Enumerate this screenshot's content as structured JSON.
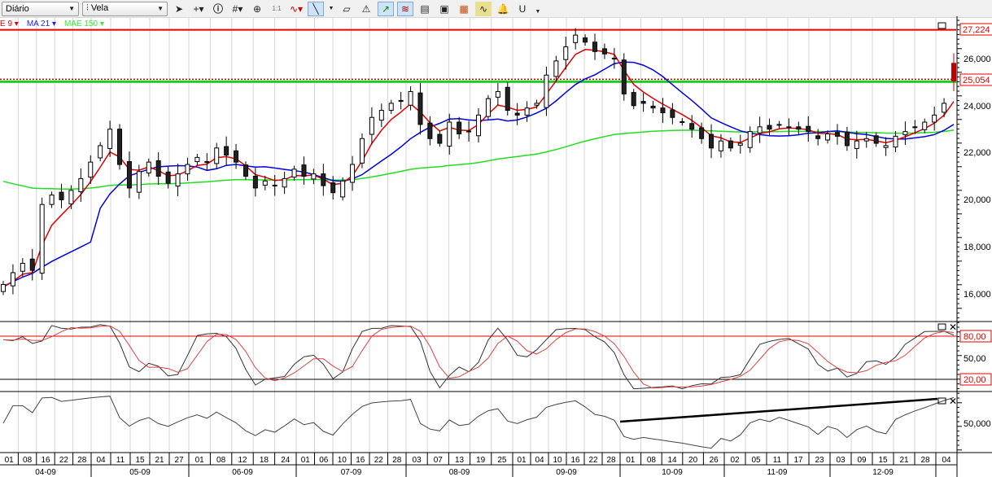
{
  "toolbar": {
    "period": "Diário",
    "chart_type": "Vela",
    "zoom_label": "1:1",
    "icons": [
      "cursor-icon",
      "crosshair-icon",
      "info-icon",
      "grid-icon",
      "zoom-icon",
      "one-to-one-icon",
      "indicator-icon",
      "trendline-icon",
      "eraser-icon",
      "alert-draw-icon",
      "line-tool-icon",
      "multi-line-icon",
      "template-icon",
      "copy-chart-icon",
      "save-chart-icon",
      "study-icon",
      "bell-icon",
      "magnet-icon",
      "more-icon"
    ]
  },
  "legend": {
    "ema": "E 9 ▾",
    "ma": "MA 21 ▾",
    "mae": "MAE 150 ▾"
  },
  "colors": {
    "ema": "#e00000",
    "ma": "#0000e0",
    "mae": "#22dd22",
    "resistance": "#e00000",
    "support": "#22cc22"
  },
  "price_axis": {
    "labels": [
      "26,000",
      "24,000",
      "22,000",
      "20,000",
      "18,000",
      "16,000"
    ],
    "resistance_label": "27,224",
    "support_label": "25,054",
    "last_label": "25,054"
  },
  "stoch_axis": {
    "upper": "80,00",
    "mid": "50,00",
    "lower": "20,00"
  },
  "rsi_axis": {
    "mid": "50,000"
  },
  "chart_data": {
    "type": "candlestick",
    "resistance": 27.224,
    "support": 25.054,
    "mae150_seed": 20.9,
    "closes": [
      16.4,
      16.9,
      17.3,
      17.0,
      19.8,
      20.2,
      20.0,
      20.4,
      20.9,
      21.6,
      22.3,
      23.0,
      21.5,
      20.5,
      21.2,
      21.6,
      21.0,
      20.7,
      21.1,
      21.5,
      21.8,
      21.6,
      22.2,
      21.9,
      21.6,
      21.0,
      20.5,
      20.8,
      20.6,
      20.9,
      21.3,
      21.0,
      21.1,
      20.6,
      20.3,
      20.8,
      21.5,
      22.6,
      23.5,
      23.8,
      24.1,
      24.2,
      24.6,
      23.2,
      22.6,
      22.4,
      23.3,
      22.8,
      22.9,
      23.6,
      24.3,
      24.6,
      23.8,
      23.6,
      23.9,
      24.1,
      25.3,
      25.9,
      26.5,
      27.0,
      26.7,
      26.3,
      26.2,
      26.0,
      24.5,
      24.0,
      24.1,
      23.9,
      23.7,
      23.5,
      23.3,
      23.0,
      22.6,
      22.2,
      22.5,
      22.2,
      22.4,
      22.9,
      23.1,
      23.0,
      23.2,
      23.1,
      23.0,
      22.9,
      22.6,
      22.8,
      22.7,
      22.3,
      22.5,
      22.6,
      22.4,
      22.3,
      22.7,
      22.9,
      23.1,
      23.3,
      23.6,
      24.1,
      25.05
    ],
    "last_open": 25.8,
    "last_high": 25.9
  },
  "x_axis": {
    "months": [
      {
        "label": "04-09",
        "days": [
          "01",
          "08",
          "16",
          "22",
          "28"
        ]
      },
      {
        "label": "05-09",
        "days": [
          "04",
          "11",
          "15",
          "21",
          "27"
        ]
      },
      {
        "label": "06-09",
        "days": [
          "01",
          "08",
          "12",
          "18",
          "24"
        ]
      },
      {
        "label": "07-09",
        "days": [
          "01",
          "06",
          "10",
          "16",
          "22",
          "28"
        ]
      },
      {
        "label": "08-09",
        "days": [
          "03",
          "07",
          "13",
          "19",
          "25"
        ]
      },
      {
        "label": "09-09",
        "days": [
          "01",
          "04",
          "10",
          "16",
          "22",
          "28"
        ]
      },
      {
        "label": "10-09",
        "days": [
          "01",
          "08",
          "14",
          "20",
          "26"
        ]
      },
      {
        "label": "11-09",
        "days": [
          "02",
          "05",
          "11",
          "17",
          "23"
        ]
      },
      {
        "label": "12-09",
        "days": [
          "03",
          "09",
          "15",
          "21",
          "28"
        ]
      },
      {
        "label": "",
        "days": [
          "04"
        ]
      }
    ]
  }
}
